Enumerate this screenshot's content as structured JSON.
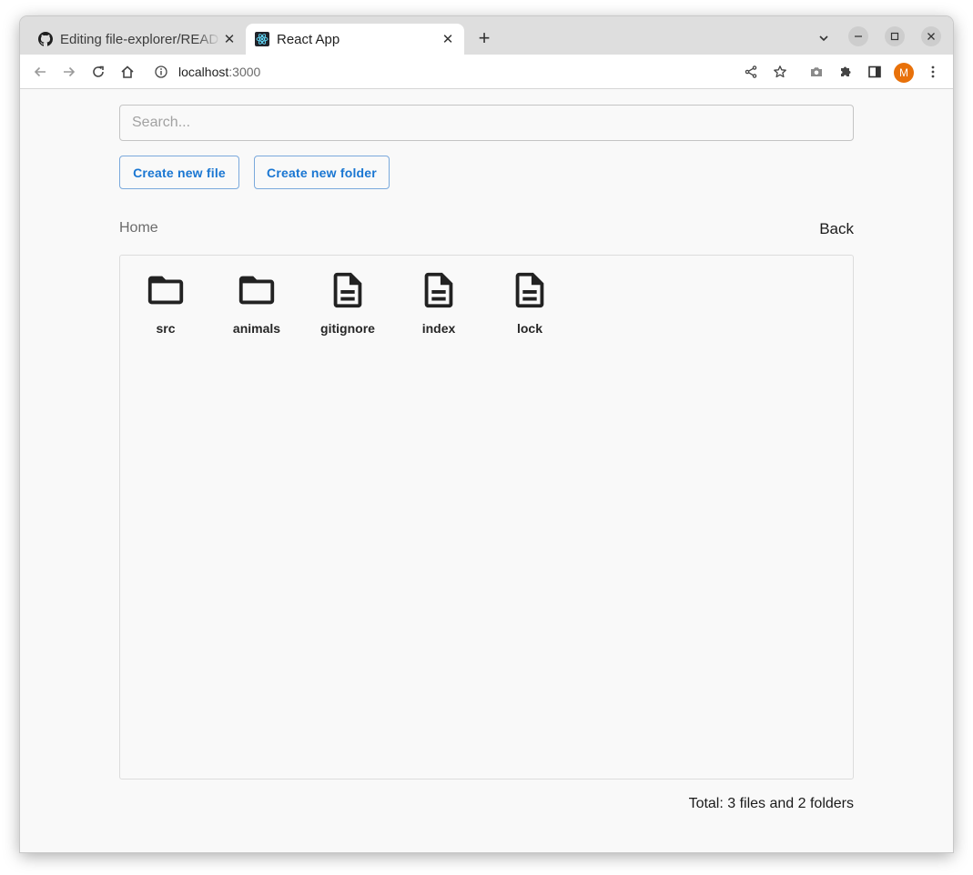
{
  "browser": {
    "tabs": [
      {
        "title": "Editing file-explorer/README.md",
        "favicon": "github-icon",
        "active": false
      },
      {
        "title": "React App",
        "favicon": "react-icon",
        "active": true
      }
    ],
    "url_host": "localhost",
    "url_port": ":3000",
    "avatar_initial": "M",
    "avatar_color": "#e8710a"
  },
  "app": {
    "search_placeholder": "Search...",
    "create_file_label": "Create new file",
    "create_folder_label": "Create new folder",
    "breadcrumb": "Home",
    "back_label": "Back",
    "items": [
      {
        "name": "src",
        "type": "folder"
      },
      {
        "name": "animals",
        "type": "folder"
      },
      {
        "name": "gitignore",
        "type": "file"
      },
      {
        "name": "index",
        "type": "file"
      },
      {
        "name": "lock",
        "type": "file"
      }
    ],
    "total_text": "Total: 3 files and 2 folders",
    "accent_color": "#1976d2"
  }
}
